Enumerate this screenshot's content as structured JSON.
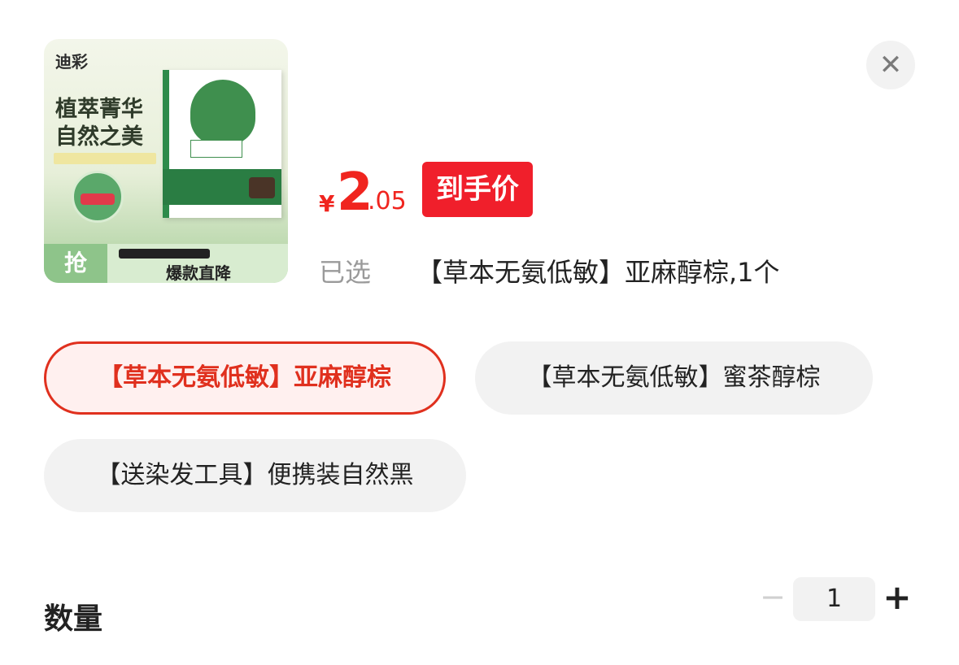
{
  "product": {
    "image_brand": "迪彩",
    "image_headline_1": "植萃菁华",
    "image_headline_2": "自然之美",
    "image_badge": "抢",
    "image_banner": "爆款直降"
  },
  "close_icon": "close-icon",
  "price": {
    "currency": "¥",
    "integer": "2",
    "decimal": ".05",
    "tag": "到手价",
    "color": "#f0251f"
  },
  "selection": {
    "label": "已选",
    "value": "【草本无氨低敏】亚麻醇棕,1个"
  },
  "options": [
    {
      "label": "【草本无氨低敏】亚麻醇棕",
      "selected": true
    },
    {
      "label": "【草本无氨低敏】蜜茶醇棕",
      "selected": false
    },
    {
      "label": "【送染发工具】便携装自然黑",
      "selected": false
    }
  ],
  "quantity": {
    "label": "数量",
    "minus": "−",
    "value": "1",
    "plus": "+"
  },
  "colors": {
    "accent": "#e0301e",
    "chip_bg": "#f2f2f2",
    "active_chip_bg": "#fff0ef"
  }
}
